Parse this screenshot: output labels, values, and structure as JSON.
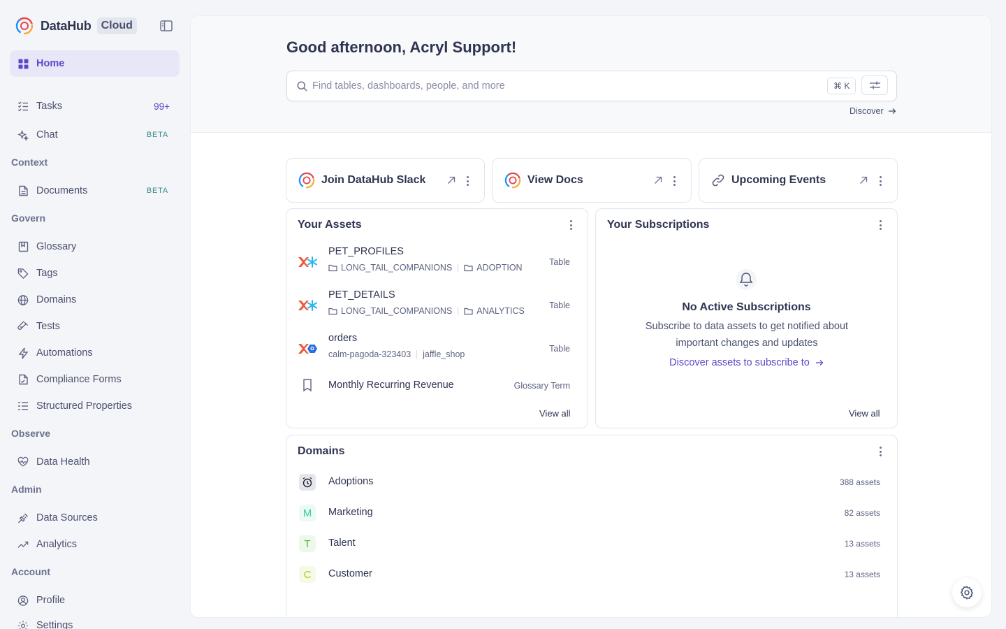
{
  "brand": {
    "name": "DataHub",
    "tag": "Cloud"
  },
  "sidebar": {
    "home": "Home",
    "tasks": {
      "label": "Tasks",
      "badge": "99+"
    },
    "chat": {
      "label": "Chat",
      "badge": "BETA"
    },
    "sections": {
      "context": "Context",
      "govern": "Govern",
      "observe": "Observe",
      "admin": "Admin",
      "account": "Account"
    },
    "documents": {
      "label": "Documents",
      "badge": "BETA"
    },
    "glossary": "Glossary",
    "tags": "Tags",
    "domains": "Domains",
    "tests": "Tests",
    "automations": "Automations",
    "compliance_forms": "Compliance Forms",
    "structured_properties": "Structured Properties",
    "data_health": "Data Health",
    "data_sources": "Data Sources",
    "analytics": "Analytics",
    "profile": "Profile",
    "settings": "Settings"
  },
  "header": {
    "greeting": "Good afternoon, Acryl Support!",
    "search_placeholder": "Find tables, dashboards, people, and more",
    "shortcut": "⌘ K",
    "discover": "Discover"
  },
  "links": [
    {
      "title": "Join DataHub Slack"
    },
    {
      "title": "View Docs"
    },
    {
      "title": "Upcoming Events"
    }
  ],
  "assets": {
    "title": "Your Assets",
    "items": [
      {
        "name": "PET_PROFILES",
        "path": [
          "LONG_TAIL_COMPANIONS",
          "ADOPTION"
        ],
        "type": "Table"
      },
      {
        "name": "PET_DETAILS",
        "path": [
          "LONG_TAIL_COMPANIONS",
          "ANALYTICS"
        ],
        "type": "Table"
      },
      {
        "name": "orders",
        "path": [
          "calm-pagoda-323403",
          "jaffle_shop"
        ],
        "type": "Table"
      },
      {
        "name": "Monthly Recurring Revenue",
        "type": "Glossary Term"
      }
    ],
    "view_all": "View all"
  },
  "subscriptions": {
    "title": "Your Subscriptions",
    "empty_title": "No Active Subscriptions",
    "empty_desc": "Subscribe to data assets to get notified about important changes and updates",
    "empty_link": "Discover assets to subscribe to",
    "view_all": "View all"
  },
  "domains": {
    "title": "Domains",
    "items": [
      {
        "name": "Adoptions",
        "count": "388 assets",
        "icon": "alarm-clock-icon"
      },
      {
        "name": "Marketing",
        "count": "82 assets",
        "letter": "M",
        "color": "#3cc9a4"
      },
      {
        "name": "Talent",
        "count": "13 assets",
        "letter": "T",
        "color": "#52b82e"
      },
      {
        "name": "Customer",
        "count": "13 assets",
        "letter": "C",
        "color": "#a6cf1b"
      }
    ]
  },
  "colors": {
    "accent": "#5a48c9",
    "beta": "#3a8a8c"
  }
}
